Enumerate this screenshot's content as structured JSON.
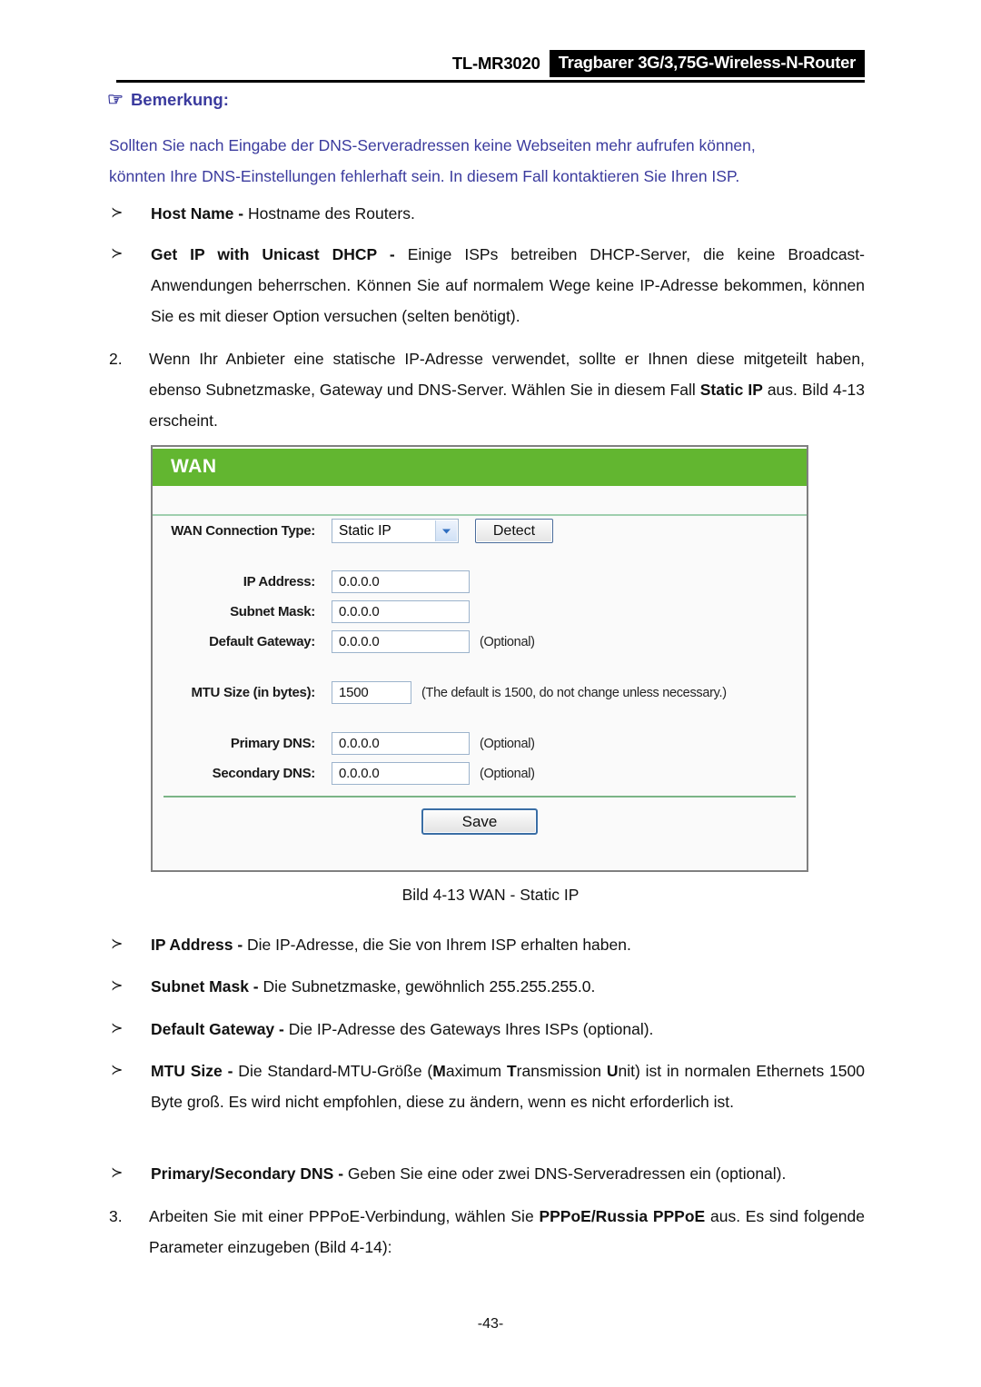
{
  "header": {
    "model_code": "TL-MR3020",
    "model_name": "Tragbarer 3G/3,75G-Wireless-N-Router"
  },
  "note": {
    "icon": "pointing-hand-icon",
    "glyph": "☞",
    "heading": "Bemerkung:",
    "line1": "Sollten Sie nach Eingabe der DNS-Serveradressen keine Webseiten mehr aufrufen können,",
    "line2": "könnten Ihre DNS-Einstellungen fehlerhaft sein. In diesem Fall kontaktieren Sie Ihren ISP.",
    "color": "#3b3b9e"
  },
  "bullets_top": [
    {
      "marker": "≻",
      "term": "Host Name -",
      "text": " Hostname des Routers."
    },
    {
      "marker": "≻",
      "term": "Get IP with Unicast DHCP -",
      "text": " Einige ISPs betreiben DHCP-Server, die keine Broadcast-Anwendungen beherrschen. Können Sie auf normalem Wege keine IP-Adresse bekommen, können Sie es mit dieser Option versuchen (selten benötigt)."
    }
  ],
  "step2": {
    "marker": "2.",
    "text_a": "Wenn Ihr Anbieter eine statische IP-Adresse verwendet, sollte er Ihnen diese mitgeteilt haben, ebenso Subnetzmaske, Gateway und DNS-Server. Wählen Sie in diesem Fall ",
    "term": "Static IP",
    "text_b": " aus. Bild 4-13 erscheint."
  },
  "screenshot": {
    "panel_title": "WAN",
    "green": "#62b630",
    "rows": [
      {
        "label": "WAN Connection Type:",
        "control": "select",
        "value": "Static IP",
        "button": "Detect"
      },
      {
        "label": "IP Address:",
        "control": "text",
        "value": "0.0.0.0",
        "hint": ""
      },
      {
        "label": "Subnet Mask:",
        "control": "text",
        "value": "0.0.0.0",
        "hint": ""
      },
      {
        "label": "Default Gateway:",
        "control": "text",
        "value": "0.0.0.0",
        "hint": "(Optional)"
      },
      {
        "label": "MTU Size (in bytes):",
        "control": "mtu",
        "value": "1500",
        "hint": "(The default is 1500, do not change unless necessary.)"
      },
      {
        "label": "Primary DNS:",
        "control": "text",
        "value": "0.0.0.0",
        "hint": "(Optional)"
      },
      {
        "label": "Secondary DNS:",
        "control": "text",
        "value": "0.0.0.0",
        "hint": "(Optional)"
      }
    ],
    "save_label": "Save"
  },
  "figure_caption": "Bild 4-13 WAN - Static IP",
  "bullets_bottom": [
    {
      "marker": "≻",
      "term": "IP Address -",
      "text": " Die IP-Adresse, die Sie von Ihrem ISP erhalten haben."
    },
    {
      "marker": "≻",
      "term": "Subnet Mask -",
      "text": " Die Subnetzmaske, gewöhnlich 255.255.255.0."
    },
    {
      "marker": "≻",
      "term": "Default Gateway -",
      "text": " Die IP-Adresse des Gateways Ihres ISPs (optional)."
    }
  ],
  "mtu_bullet": {
    "marker": "≻",
    "term": "MTU Size -",
    "p1": " Die Standard-MTU-Größe (",
    "m": "M",
    "p2": "aximum ",
    "t": "T",
    "p3": "ransmission ",
    "u": "U",
    "p4": "nit) ist in normalen Ethernets 1500 Byte groß. Es wird nicht empfohlen, diese zu ändern, wenn es nicht erforderlich ist."
  },
  "dns_bullet": {
    "marker": "≻",
    "term": "Primary/Secondary DNS -",
    "text": " Geben Sie eine oder zwei DNS-Serveradressen ein (optional)."
  },
  "step3": {
    "marker": "3.",
    "text_a": "Arbeiten Sie mit einer PPPoE-Verbindung, wählen Sie ",
    "term": "PPPoE/Russia PPPoE",
    "text_b": " aus. Es sind folgende Parameter einzugeben (Bild 4-14):"
  },
  "footer": {
    "page_number": "-43-"
  }
}
